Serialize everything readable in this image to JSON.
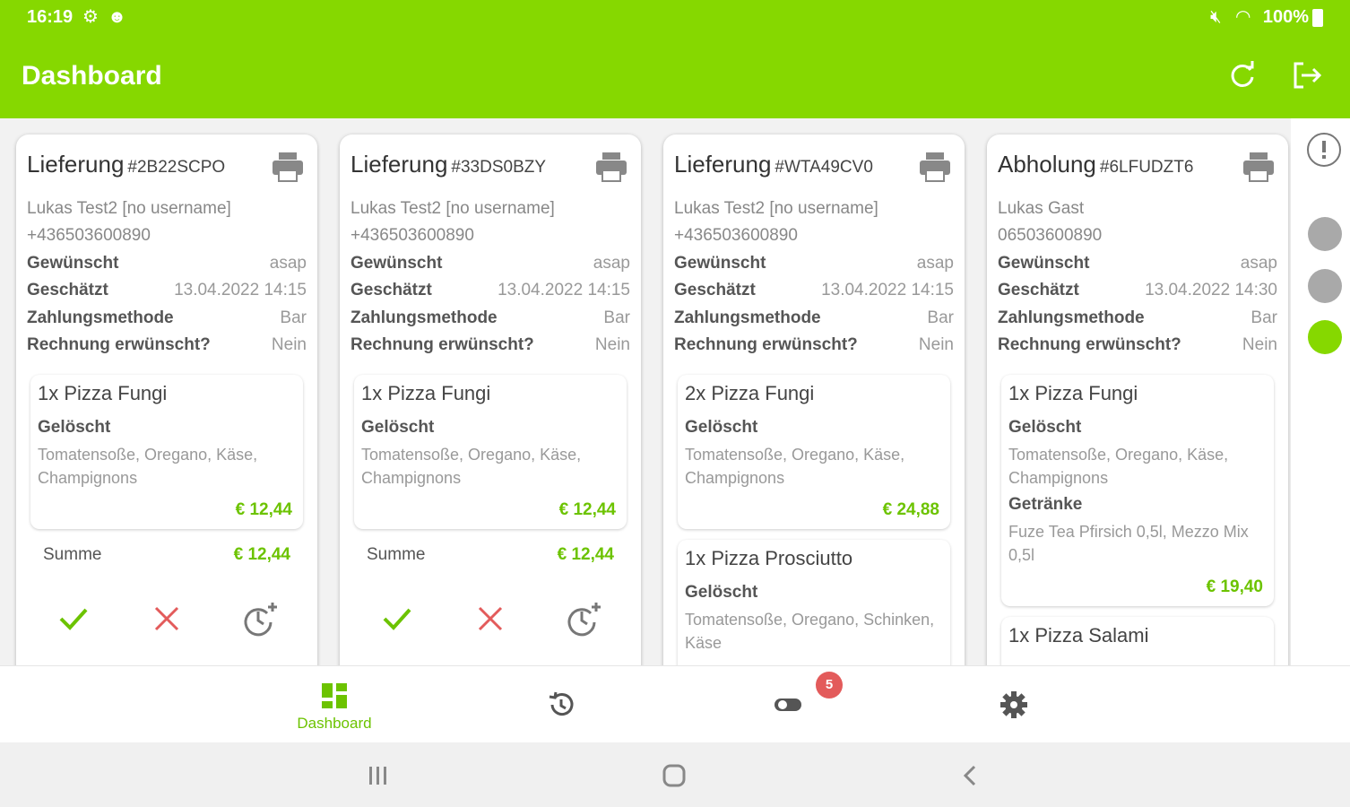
{
  "status": {
    "time": "16:19",
    "battery": "100%"
  },
  "appbar": {
    "title": "Dashboard"
  },
  "colors": {
    "accent": "#86d800",
    "price": "#6cc300",
    "reject": "#e35b5b"
  },
  "orders": [
    {
      "type": "Lieferung",
      "code": "#2B22SCPO",
      "customer": "Lukas Test2 [no username]",
      "phone": "+436503600890",
      "rows": [
        {
          "k": "Gewünscht",
          "v": "asap"
        },
        {
          "k": "Geschätzt",
          "v": "13.04.2022 14:15"
        },
        {
          "k": "Zahlungsmethode",
          "v": "Bar"
        },
        {
          "k": "Rechnung erwünscht?",
          "v": "Nein"
        }
      ],
      "items": [
        {
          "name": "1x Pizza Fungi",
          "category": "Gelöscht",
          "desc": "Tomatensoße, Oregano, Käse, Champignons",
          "price": "€ 12,44"
        }
      ],
      "sum_label": "Summe",
      "sum": "€ 12,44"
    },
    {
      "type": "Lieferung",
      "code": "#33DS0BZY",
      "customer": "Lukas Test2 [no username]",
      "phone": "+436503600890",
      "rows": [
        {
          "k": "Gewünscht",
          "v": "asap"
        },
        {
          "k": "Geschätzt",
          "v": "13.04.2022 14:15"
        },
        {
          "k": "Zahlungsmethode",
          "v": "Bar"
        },
        {
          "k": "Rechnung erwünscht?",
          "v": "Nein"
        }
      ],
      "items": [
        {
          "name": "1x Pizza Fungi",
          "category": "Gelöscht",
          "desc": "Tomatensoße, Oregano, Käse, Champignons",
          "price": "€ 12,44"
        }
      ],
      "sum_label": "Summe",
      "sum": "€ 12,44"
    },
    {
      "type": "Lieferung",
      "code": "#WTA49CV0",
      "customer": "Lukas Test2 [no username]",
      "phone": "+436503600890",
      "rows": [
        {
          "k": "Gewünscht",
          "v": "asap"
        },
        {
          "k": "Geschätzt",
          "v": "13.04.2022 14:15"
        },
        {
          "k": "Zahlungsmethode",
          "v": "Bar"
        },
        {
          "k": "Rechnung erwünscht?",
          "v": "Nein"
        }
      ],
      "items": [
        {
          "name": "2x Pizza Fungi",
          "category": "Gelöscht",
          "desc": "Tomatensoße, Oregano, Käse, Champignons",
          "price": "€ 24,88"
        },
        {
          "name": "1x Pizza Prosciutto",
          "category": "Gelöscht",
          "desc": "Tomatensoße, Oregano, Schinken, Käse",
          "price": ""
        }
      ]
    },
    {
      "type": "Abholung",
      "code": "#6LFUDZT6",
      "customer": "Lukas Gast",
      "phone": "06503600890",
      "rows": [
        {
          "k": "Gewünscht",
          "v": "asap"
        },
        {
          "k": "Geschätzt",
          "v": "13.04.2022 14:30"
        },
        {
          "k": "Zahlungsmethode",
          "v": "Bar"
        },
        {
          "k": "Rechnung erwünscht?",
          "v": "Nein"
        }
      ],
      "items": [
        {
          "name": "1x Pizza Fungi",
          "category": "Gelöscht",
          "desc": "Tomatensoße, Oregano, Käse, Champignons",
          "category2": "Getränke",
          "desc2": "Fuze Tea Pfirsich 0,5l, Mezzo Mix 0,5l",
          "price": "€ 19,40"
        },
        {
          "name": "1x Pizza Salami"
        }
      ]
    }
  ],
  "bottomnav": {
    "dashboard_label": "Dashboard",
    "badge": "5"
  }
}
